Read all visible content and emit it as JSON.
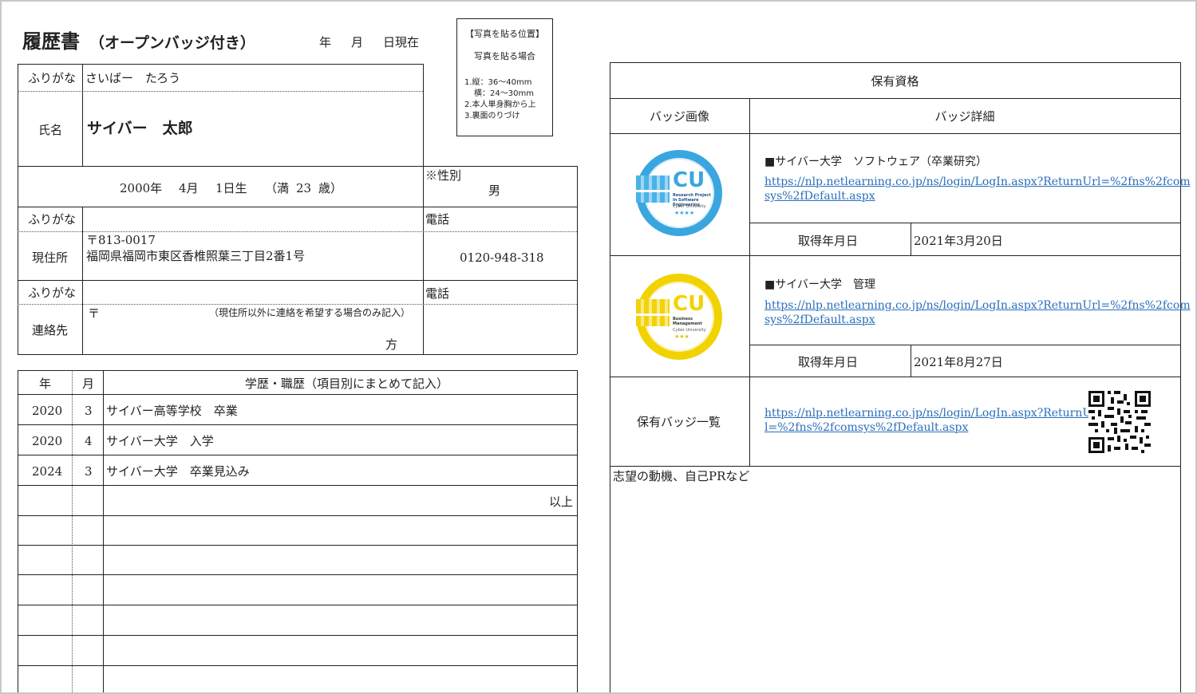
{
  "title": {
    "main": "履歴書",
    "sub": "（オープンバッジ付き）",
    "date_year": "年",
    "date_month": "月",
    "date_day": "日現在"
  },
  "photo_box": {
    "heading": "【写真を貼る位置】",
    "sub": "写真を貼る場合",
    "line1": "1.縦：36～40mm",
    "line2": "横：24～30mm",
    "line3": "2.本人単身胸から上",
    "line4": "3.裏面のりづけ"
  },
  "personal": {
    "furigana_label": "ふりがな",
    "furigana_value": "さいばー　たろう",
    "name_label": "氏名",
    "name_value": "サイバー　太郎",
    "birth_year": "2000年",
    "birth_month": "4月",
    "birth_day": "1日生",
    "age_open": "（満",
    "age_value": "23",
    "age_close": "歳）",
    "gender_label": "※性別",
    "gender_value": "男",
    "furigana2_label": "ふりがな",
    "phone_label": "電話",
    "address_label": "現住所",
    "postal": "〒813-0017",
    "address_value": "福岡県福岡市東区香椎照葉三丁目2番1号",
    "phone_value": "0120-948-318",
    "furigana3_label": "ふりがな",
    "phone2_label": "電話",
    "contact_label": "連絡先",
    "contact_postal": "〒",
    "contact_note": "（現住所以外に連絡を希望する場合のみ記入）",
    "contact_suffix": "方"
  },
  "history": {
    "col_year": "年",
    "col_month": "月",
    "col_content": "学歴・職歴（項目別にまとめて記入）",
    "rows": [
      {
        "year": "2020",
        "month": "3",
        "content": "サイバー高等学校　卒業"
      },
      {
        "year": "2020",
        "month": "4",
        "content": "サイバー大学　入学"
      },
      {
        "year": "2024",
        "month": "3",
        "content": "サイバー大学　卒業見込み"
      }
    ],
    "end_text": "以上"
  },
  "qualifications": {
    "header": "保有資格",
    "col_image": "バッジ画像",
    "col_detail": "バッジ詳細",
    "badges": [
      {
        "title": "■サイバー大学　ソフトウェア（卒業研究）",
        "url_line1": "https://nlp.netlearning.co.jp/ns/login/LogIn.aspx?ReturnUrl=%2fns%2fcom",
        "url_line2": "sys%2fDefault.aspx",
        "date_label": "取得年月日",
        "date_value": "2021年3月20日",
        "badge_text": "Research Project in Software Engineering",
        "badge_sub": "Cyber University",
        "color": "#3aa6e0"
      },
      {
        "title": "■サイバー大学　管理",
        "url_line1": "https://nlp.netlearning.co.jp/ns/login/LogIn.aspx?ReturnUrl=%2fns%2fcom",
        "url_line2": "sys%2fDefault.aspx",
        "date_label": "取得年月日",
        "date_value": "2021年8月27日",
        "badge_text": "Business Management",
        "badge_sub": "Cyber University",
        "color": "#f2d200"
      }
    ],
    "list_label": "保有バッジ一覧",
    "list_url_line1": "https://nlp.netlearning.co.jp/ns/login/LogIn.aspx?ReturnUr",
    "list_url_line2": "l=%2fns%2fcomsys%2fDefault.aspx",
    "motivation_label": "志望の動機、自己PRなど"
  }
}
